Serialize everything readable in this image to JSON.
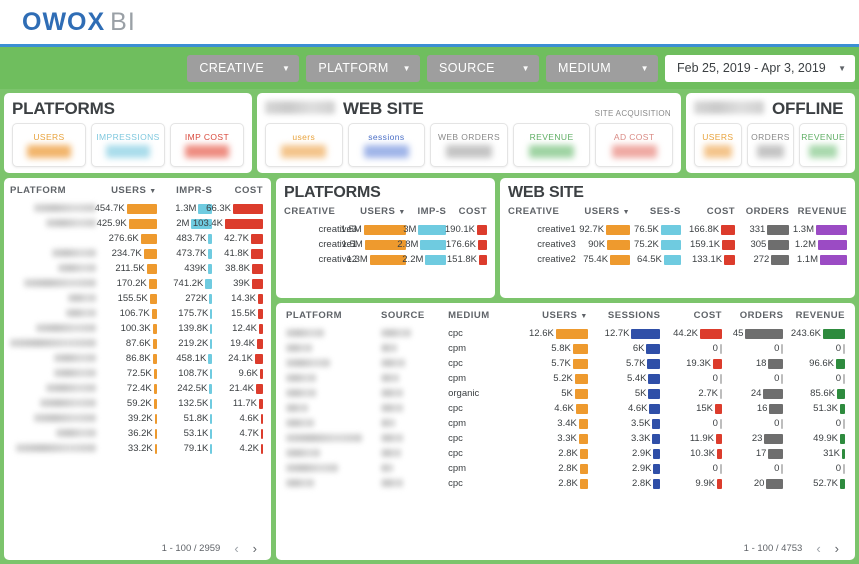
{
  "brand": {
    "name_primary": "OWOX",
    "name_secondary": "BI"
  },
  "filters": {
    "chips": [
      {
        "label": "CREATIVE",
        "caret": "chevron-down-icon"
      },
      {
        "label": "PLATFORM",
        "caret": "chevron-down-icon"
      },
      {
        "label": "SOURCE",
        "caret": "chevron-down-icon"
      },
      {
        "label": "MEDIUM",
        "caret": "chevron-down-icon"
      }
    ],
    "date_range": {
      "value": "Feb 25, 2019 - Apr 3, 2019",
      "caret": "chevron-down-icon"
    }
  },
  "scorecards": [
    {
      "title": "PLATFORMS",
      "title_redacted": false,
      "subtitle": "",
      "kpis": [
        {
          "label": "USERS",
          "label_color": "#E8A33D",
          "value_color": "#F2B46A",
          "redacted": true
        },
        {
          "label": "IMPRESSIONS",
          "label_color": "#7FC8DE",
          "value_color": "#A9DCEB",
          "redacted": true
        },
        {
          "label": "IMP COST",
          "label_color": "#D94A3D",
          "value_color": "#EE8C80",
          "redacted": true
        }
      ]
    },
    {
      "title": "WEB SITE",
      "title_redacted": true,
      "subtitle": "SITE ACQUISITION",
      "kpis": [
        {
          "label": "users",
          "label_color": "#E8A33D",
          "value_color": "#F4C48A",
          "redacted": true
        },
        {
          "label": "sessions",
          "label_color": "#4A6FC7",
          "value_color": "#9FB4E8",
          "redacted": true
        },
        {
          "label": "WEB ORDERS",
          "label_color": "#8A8A8A",
          "value_color": "#C4C4C4",
          "redacted": true
        },
        {
          "label": "REVENUE",
          "label_color": "#5FAE64",
          "value_color": "#9ED3A2",
          "redacted": true
        },
        {
          "label": "AD COST",
          "label_color": "#D98A84",
          "value_color": "#EFA9A2",
          "redacted": true
        }
      ]
    },
    {
      "title": "OFFLINE",
      "title_redacted": true,
      "subtitle": "",
      "kpis": [
        {
          "label": "USERS",
          "label_color": "#E8A33D",
          "value_color": "#F4C48A",
          "redacted": true
        },
        {
          "label": "ORDERS",
          "label_color": "#8A8A8A",
          "value_color": "#C4C4C4",
          "redacted": true
        },
        {
          "label": "REVENUE",
          "label_color": "#5FAE64",
          "value_color": "#A8D8AC",
          "redacted": true
        }
      ]
    }
  ],
  "left_table": {
    "columns": [
      "PLATFORM",
      "USERS",
      "IMPR-S",
      "COST"
    ],
    "sorted_column": "USERS",
    "rows": [
      {
        "platform_redacted": true,
        "redact_w": 62,
        "users": "454.7K",
        "users_bar": 30,
        "imprs": "1.3M",
        "imprs_bar": 14,
        "cost": "66.3K",
        "cost_bar": 30
      },
      {
        "platform_redacted": true,
        "redact_w": 50,
        "users": "425.9K",
        "users_bar": 28,
        "imprs": "2M",
        "imprs_bar": 21,
        "cost": "103.4K",
        "cost_bar": 38
      },
      {
        "platform_redacted": true,
        "redact_w": 0,
        "users": "276.6K",
        "users_bar": 16,
        "imprs": "483.7K",
        "imprs_bar": 4,
        "cost": "42.7K",
        "cost_bar": 12
      },
      {
        "platform_redacted": true,
        "redact_w": 44,
        "users": "234.7K",
        "users_bar": 13,
        "imprs": "473.7K",
        "imprs_bar": 4,
        "cost": "41.8K",
        "cost_bar": 12
      },
      {
        "platform_redacted": true,
        "redact_w": 38,
        "users": "211.5K",
        "users_bar": 10,
        "imprs": "439K",
        "imprs_bar": 4,
        "cost": "38.8K",
        "cost_bar": 11
      },
      {
        "platform_redacted": true,
        "redact_w": 72,
        "users": "170.2K",
        "users_bar": 8,
        "imprs": "741.2K",
        "imprs_bar": 7,
        "cost": "39K",
        "cost_bar": 11
      },
      {
        "platform_redacted": true,
        "redact_w": 28,
        "users": "155.5K",
        "users_bar": 7,
        "imprs": "272K",
        "imprs_bar": 3,
        "cost": "14.3K",
        "cost_bar": 5
      },
      {
        "platform_redacted": true,
        "redact_w": 30,
        "users": "106.7K",
        "users_bar": 5,
        "imprs": "175.7K",
        "imprs_bar": 2,
        "cost": "15.5K",
        "cost_bar": 5
      },
      {
        "platform_redacted": true,
        "redact_w": 60,
        "users": "100.3K",
        "users_bar": 4,
        "imprs": "139.8K",
        "imprs_bar": 2,
        "cost": "12.4K",
        "cost_bar": 4
      },
      {
        "platform_redacted": true,
        "redact_w": 86,
        "users": "87.6K",
        "users_bar": 4,
        "imprs": "219.2K",
        "imprs_bar": 2,
        "cost": "19.4K",
        "cost_bar": 6
      },
      {
        "platform_redacted": true,
        "redact_w": 42,
        "users": "86.8K",
        "users_bar": 4,
        "imprs": "458.1K",
        "imprs_bar": 4,
        "cost": "24.1K",
        "cost_bar": 8
      },
      {
        "platform_redacted": true,
        "redact_w": 42,
        "users": "72.5K",
        "users_bar": 3,
        "imprs": "108.7K",
        "imprs_bar": 2,
        "cost": "9.6K",
        "cost_bar": 3
      },
      {
        "platform_redacted": true,
        "redact_w": 50,
        "users": "72.4K",
        "users_bar": 3,
        "imprs": "242.5K",
        "imprs_bar": 3,
        "cost": "21.4K",
        "cost_bar": 7
      },
      {
        "platform_redacted": true,
        "redact_w": 56,
        "users": "59.2K",
        "users_bar": 3,
        "imprs": "132.5K",
        "imprs_bar": 2,
        "cost": "11.7K",
        "cost_bar": 4
      },
      {
        "platform_redacted": true,
        "redact_w": 62,
        "users": "39.2K",
        "users_bar": 2,
        "imprs": "51.8K",
        "imprs_bar": 2,
        "cost": "4.6K",
        "cost_bar": 2
      },
      {
        "platform_redacted": true,
        "redact_w": 40,
        "users": "36.2K",
        "users_bar": 2,
        "imprs": "53.1K",
        "imprs_bar": 2,
        "cost": "4.7K",
        "cost_bar": 2
      },
      {
        "platform_redacted": true,
        "redact_w": 80,
        "users": "33.2K",
        "users_bar": 2,
        "imprs": "79.1K",
        "imprs_bar": 2,
        "cost": "4.2K",
        "cost_bar": 2
      }
    ],
    "pagination": {
      "range": "1 - 100 / 2959",
      "prev": "prev-page-icon",
      "next": "next-page-icon"
    }
  },
  "platforms_table": {
    "title": "PLATFORMS",
    "columns": [
      "CREATIVE",
      "USERS",
      "IMP-S",
      "COST"
    ],
    "sorted_column": "USERS",
    "rows": [
      {
        "creative": "creative3",
        "users": "1.5M",
        "users_bar": 42,
        "imps": "3M",
        "imps_bar": 28,
        "cost": "190.1K",
        "cost_bar": 10
      },
      {
        "creative": "creative1",
        "users": "1.5M",
        "users_bar": 41,
        "imps": "2.8M",
        "imps_bar": 26,
        "cost": "176.6K",
        "cost_bar": 9
      },
      {
        "creative": "creative2",
        "users": "1.3M",
        "users_bar": 36,
        "imps": "2.2M",
        "imps_bar": 21,
        "cost": "151.8K",
        "cost_bar": 8
      }
    ]
  },
  "website_table": {
    "title": "WEB SITE",
    "columns": [
      "CREATIVE",
      "USERS",
      "SES-S",
      "COST",
      "ORDERS",
      "REVENUE"
    ],
    "sorted_column": "USERS",
    "rows": [
      {
        "creative": "creative1",
        "users": "92.7K",
        "users_bar": 24,
        "sess": "76.5K",
        "sess_bar": 20,
        "cost": "166.8K",
        "cost_bar": 14,
        "orders": "331",
        "orders_bar": 22,
        "revenue": "1.3M",
        "revenue_bar": 31
      },
      {
        "creative": "creative3",
        "users": "90K",
        "users_bar": 23,
        "sess": "75.2K",
        "sess_bar": 20,
        "cost": "159.1K",
        "cost_bar": 13,
        "orders": "305",
        "orders_bar": 21,
        "revenue": "1.2M",
        "revenue_bar": 29
      },
      {
        "creative": "creative2",
        "users": "75.4K",
        "users_bar": 20,
        "sess": "64.5K",
        "sess_bar": 17,
        "cost": "133.1K",
        "cost_bar": 11,
        "orders": "272",
        "orders_bar": 18,
        "revenue": "1.1M",
        "revenue_bar": 27
      }
    ]
  },
  "detail_table": {
    "columns": [
      "PLATFORM",
      "SOURCE",
      "MEDIUM",
      "USERS",
      "SESSIONS",
      "COST",
      "ORDERS",
      "REVENUE"
    ],
    "sorted_column": "USERS",
    "rows": [
      {
        "platform_redacted": true,
        "p_w": 38,
        "source_redacted": true,
        "s_w": 30,
        "medium": "cpc",
        "users": "12.6K",
        "users_bar": 32,
        "sessions": "12.7K",
        "sessions_bar": 29,
        "cost": "44.2K",
        "cost_bar": 22,
        "orders": "45",
        "orders_bar": 38,
        "revenue": "243.6K",
        "revenue_bar": 22
      },
      {
        "platform_redacted": true,
        "p_w": 26,
        "source_redacted": true,
        "s_w": 16,
        "medium": "cpm",
        "users": "5.8K",
        "users_bar": 15,
        "sessions": "6K",
        "sessions_bar": 14,
        "cost": "0",
        "cost_bar": 0,
        "orders": "0",
        "orders_bar": 0,
        "revenue": "0",
        "revenue_bar": 0
      },
      {
        "platform_redacted": true,
        "p_w": 44,
        "source_redacted": true,
        "s_w": 24,
        "medium": "cpc",
        "users": "5.7K",
        "users_bar": 15,
        "sessions": "5.7K",
        "sessions_bar": 13,
        "cost": "19.3K",
        "cost_bar": 9,
        "orders": "18",
        "orders_bar": 15,
        "revenue": "96.6K",
        "revenue_bar": 9
      },
      {
        "platform_redacted": true,
        "p_w": 30,
        "source_redacted": true,
        "s_w": 18,
        "medium": "cpm",
        "users": "5.2K",
        "users_bar": 13,
        "sessions": "5.4K",
        "sessions_bar": 12,
        "cost": "0",
        "cost_bar": 0,
        "orders": "0",
        "orders_bar": 0,
        "revenue": "0",
        "revenue_bar": 0
      },
      {
        "platform_redacted": true,
        "p_w": 30,
        "source_redacted": true,
        "s_w": 22,
        "medium": "organic",
        "users": "5K",
        "users_bar": 13,
        "sessions": "5K",
        "sessions_bar": 12,
        "cost": "2.7K",
        "cost_bar": 0,
        "orders": "24",
        "orders_bar": 20,
        "revenue": "85.6K",
        "revenue_bar": 8
      },
      {
        "platform_redacted": true,
        "p_w": 22,
        "source_redacted": true,
        "s_w": 22,
        "medium": "cpc",
        "users": "4.6K",
        "users_bar": 12,
        "sessions": "4.6K",
        "sessions_bar": 11,
        "cost": "15K",
        "cost_bar": 7,
        "orders": "16",
        "orders_bar": 14,
        "revenue": "51.3K",
        "revenue_bar": 5
      },
      {
        "platform_redacted": true,
        "p_w": 28,
        "source_redacted": true,
        "s_w": 14,
        "medium": "cpm",
        "users": "3.4K",
        "users_bar": 9,
        "sessions": "3.5K",
        "sessions_bar": 8,
        "cost": "0",
        "cost_bar": 0,
        "orders": "0",
        "orders_bar": 0,
        "revenue": "0",
        "revenue_bar": 0
      },
      {
        "platform_redacted": true,
        "p_w": 76,
        "source_redacted": true,
        "s_w": 22,
        "medium": "cpc",
        "users": "3.3K",
        "users_bar": 9,
        "sessions": "3.3K",
        "sessions_bar": 8,
        "cost": "11.9K",
        "cost_bar": 6,
        "orders": "23",
        "orders_bar": 19,
        "revenue": "49.9K",
        "revenue_bar": 5
      },
      {
        "platform_redacted": true,
        "p_w": 34,
        "source_redacted": true,
        "s_w": 20,
        "medium": "cpc",
        "users": "2.8K",
        "users_bar": 8,
        "sessions": "2.9K",
        "sessions_bar": 7,
        "cost": "10.3K",
        "cost_bar": 5,
        "orders": "17",
        "orders_bar": 15,
        "revenue": "31K",
        "revenue_bar": 3
      },
      {
        "platform_redacted": true,
        "p_w": 52,
        "source_redacted": true,
        "s_w": 12,
        "medium": "cpm",
        "users": "2.8K",
        "users_bar": 8,
        "sessions": "2.9K",
        "sessions_bar": 7,
        "cost": "0",
        "cost_bar": 0,
        "orders": "0",
        "orders_bar": 0,
        "revenue": "0",
        "revenue_bar": 0
      },
      {
        "platform_redacted": true,
        "p_w": 28,
        "source_redacted": true,
        "s_w": 22,
        "medium": "cpc",
        "users": "2.8K",
        "users_bar": 8,
        "sessions": "2.8K",
        "sessions_bar": 7,
        "cost": "9.9K",
        "cost_bar": 5,
        "orders": "20",
        "orders_bar": 17,
        "revenue": "52.7K",
        "revenue_bar": 5
      }
    ],
    "pagination": {
      "range": "1 - 100 / 4753",
      "prev": "prev-page-icon",
      "next": "next-page-icon"
    }
  },
  "colors": {
    "green_band": "#6FBE5E",
    "page_green": "#7CC46C",
    "blue_rule": "#3B8FD4",
    "users_bar": "#EE9A2E",
    "imprs_bar": "#6FCBE0",
    "cost_bar": "#DC3C2C",
    "sessions_bar": "#2F4FA8",
    "orders_bar": "#6E6E6E",
    "revenue_bar": "#9B4BC4",
    "revenue_green_bar": "#2E8B3E"
  }
}
